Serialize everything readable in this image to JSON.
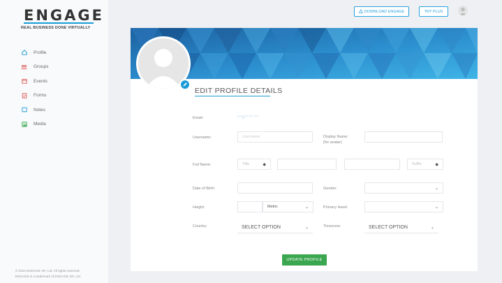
{
  "brand": {
    "logo_text": "ENGAGE",
    "tagline": "REAL BUSINESS DONE VIRTUALLY",
    "accent_color": "#1a9bd7"
  },
  "header": {
    "download_label": "DOWNLOAD ENGAGE",
    "try_label": "TRY PLUS"
  },
  "sidebar": {
    "items": [
      {
        "label": "Profile",
        "icon": "home-icon",
        "color": "#1a9bd7"
      },
      {
        "label": "Groups",
        "icon": "groups-icon",
        "color": "#d9534f"
      },
      {
        "label": "Events",
        "icon": "calendar-icon",
        "color": "#d9534f"
      },
      {
        "label": "Forms",
        "icon": "form-icon",
        "color": "#d9534f"
      },
      {
        "label": "Notes",
        "icon": "notes-icon",
        "color": "#1a9bd7"
      },
      {
        "label": "Media",
        "icon": "media-icon",
        "color": "#3aa64f"
      }
    ]
  },
  "footer": {
    "line1": "© 2022 ENGAGE XR, Ltd. All rights reserved.",
    "line2": "ENGAGE is a trademark of ENGAGE XR, Ltd."
  },
  "profile": {
    "title": "EDIT PROFILE DETAILS",
    "fields": {
      "email_label": "Email:",
      "email_value": "t**@*****.***",
      "username_label": "Username:",
      "username_placeholder": "Username",
      "display_name_label": "Display Name:",
      "display_name_hint": "(for avatar)",
      "fullname_label": "Full Name:",
      "title_value": "Title",
      "suffix_value": "Suffix",
      "dob_label": "Date of Birth:",
      "gender_label": "Gender:",
      "height_label": "Height:",
      "height_unit": "Metric",
      "primary_hand_label": "Primary Hand:",
      "country_label": "Country:",
      "country_value": "SELECT OPTION",
      "timezone_label": "Timezone:",
      "timezone_value": "SELECT OPTION"
    },
    "update_label": "UPDATE PROFILE"
  }
}
